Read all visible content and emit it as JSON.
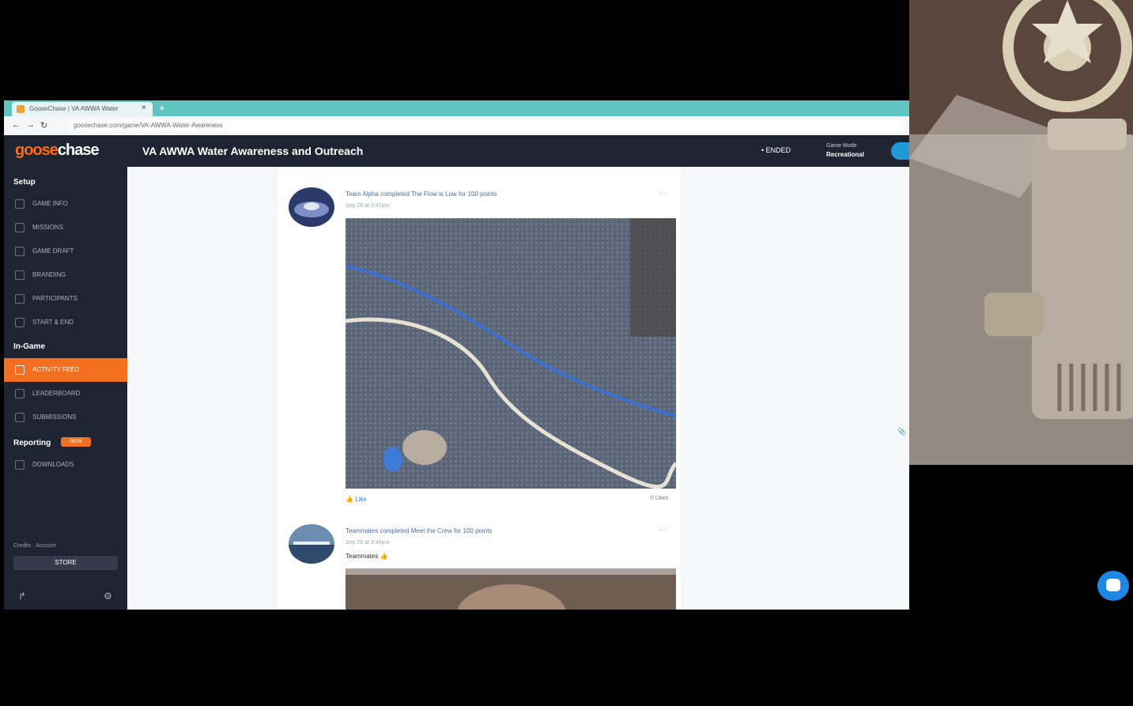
{
  "browser": {
    "tab_title": "GooseChase | VA AWWA Water",
    "url": "goosechase.com/game/VA-AWWA-Water-Awareness"
  },
  "header": {
    "logo_goose": "goose",
    "logo_chase": "chase",
    "game_title": "VA AWWA Water Awareness and Outreach",
    "status": "• ENDED",
    "info_line": "Game Mode",
    "info_value": "Recreational"
  },
  "sidebar": {
    "setup_heading": "Setup",
    "setup_items": [
      {
        "label": "GAME INFO",
        "icon": "pencil-icon"
      },
      {
        "label": "MISSIONS",
        "icon": "target-icon"
      },
      {
        "label": "GAME DRAFT",
        "icon": "pencil-icon"
      },
      {
        "label": "BRANDING",
        "icon": "image-icon"
      },
      {
        "label": "PARTICIPANTS",
        "icon": "users-icon"
      },
      {
        "label": "START & END",
        "icon": "clock-icon"
      }
    ],
    "ingame_heading": "In-Game",
    "ingame_items": [
      {
        "label": "ACTIVITY FEED",
        "icon": "feed-icon",
        "active": true
      },
      {
        "label": "LEADERBOARD",
        "icon": "trophy-icon",
        "active": false
      },
      {
        "label": "SUBMISSIONS",
        "icon": "inbox-icon",
        "active": false
      }
    ],
    "reporting_heading": "Reporting",
    "reporting_badge": "NEW",
    "reporting_items": [
      {
        "label": "DOWNLOADS",
        "icon": "download-icon"
      }
    ],
    "account_text": "Credits · Account",
    "store_button": "STORE",
    "accent_color": "#f26f21"
  },
  "feed": {
    "posts": [
      {
        "title": "Team Alpha completed The Flow is Low for 100 points",
        "time": "Sep 26 at 3:47pm",
        "like_label": "Like",
        "likes_count": "0 Likes"
      },
      {
        "title": "Teammates completed Meet the Crew for 100 points",
        "time": "Sep 26 at 3:44pm",
        "caption": "Teammates 👍"
      }
    ]
  },
  "sidehint": "📎"
}
